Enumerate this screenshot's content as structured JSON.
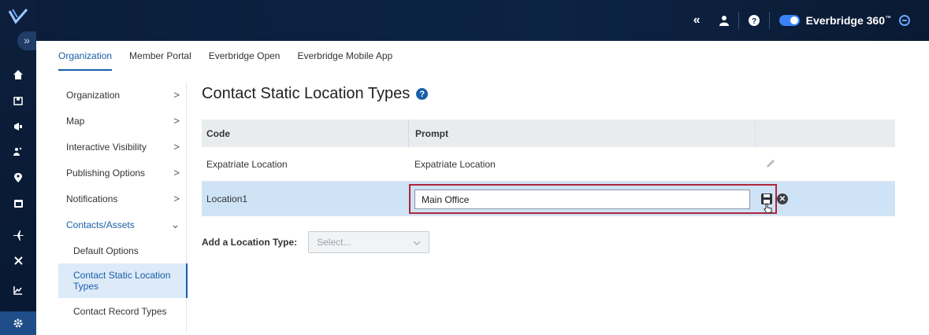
{
  "topbar": {
    "collapse_icon": "«",
    "brand_name": "Everbridge 360",
    "brand_tm": "™"
  },
  "tabs": [
    "Organization",
    "Member Portal",
    "Everbridge Open",
    "Everbridge Mobile App"
  ],
  "sidenav": {
    "items": [
      {
        "label": "Organization",
        "chevron": ">"
      },
      {
        "label": "Map",
        "chevron": ">"
      },
      {
        "label": "Interactive Visibility",
        "chevron": ">"
      },
      {
        "label": "Publishing Options",
        "chevron": ">"
      },
      {
        "label": "Notifications",
        "chevron": ">"
      },
      {
        "label": "Contacts/Assets",
        "chevron": "⌄"
      }
    ],
    "subitems": [
      "Default Options",
      "Contact Static Location Types",
      "Contact Record Types"
    ]
  },
  "page": {
    "title": "Contact Static Location Types",
    "help": "?"
  },
  "table": {
    "headers": [
      "Code",
      "Prompt"
    ],
    "rows": [
      {
        "code": "Expatriate Location",
        "prompt": "Expatriate Location"
      },
      {
        "code": "Location1",
        "prompt": "Main Office"
      }
    ]
  },
  "add_location": {
    "label": "Add a Location Type:",
    "placeholder": "Select..."
  },
  "colors": {
    "accent": "#1a5fa8",
    "selected_row": "#cfe3f6",
    "highlight_border": "#b0263a"
  }
}
